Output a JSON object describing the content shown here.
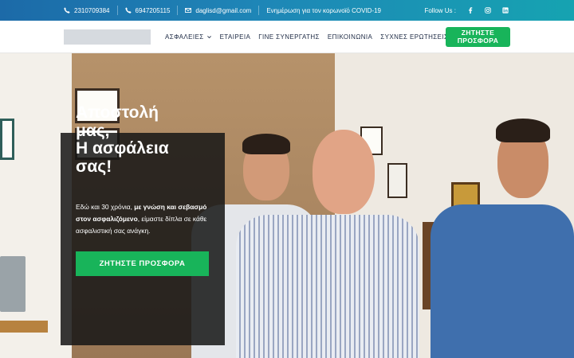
{
  "topbar": {
    "phone1": "2310709384",
    "phone2": "6947205115",
    "email": "daglisd@gmail.com",
    "covid_link": "Ενημέρωση για τον κορωνοϊό COVID-19",
    "follow_label": "Follow Us :",
    "social": [
      "facebook-icon",
      "instagram-icon",
      "linkedin-icon"
    ]
  },
  "header": {
    "nav": [
      {
        "label": "ΑΣΦΑΛΕΙΕΣ",
        "has_dropdown": true
      },
      {
        "label": "ΕΤΑΙΡΕΙΑ"
      },
      {
        "label": "ΓΙΝΕ ΣΥΝΕΡΓΑΤΗΣ"
      },
      {
        "label": "ΕΠΙΚΟΙΝΩΝΙΑ"
      },
      {
        "label": "ΣΥΧΝΕΣ ΕΡΩΤΗΣΕΙΣ"
      }
    ],
    "cta_line1": "ΖΗΤΗΣΤΕ",
    "cta_line2": "ΠΡΟΣΦΟΡΑ"
  },
  "hero": {
    "title_line1": "Αποστολή",
    "title_line2": "μας,",
    "title_line3": "Η ασφάλεια",
    "title_line4": "σας!",
    "text_part1": "Εδώ και 30 χρόνια, ",
    "text_bold": "με γνώση και σεβασμό στον ασφαλιζόμενο",
    "text_part2": ", είμαστε δίπλα σε κάθε ασφαλιστική σας ανάγκη.",
    "cta": "ΖΗΤΗΣΤΕ ΠΡΟΣΦΟΡΑ"
  },
  "colors": {
    "topbar_start": "#1c6aa8",
    "topbar_end": "#16a3b1",
    "accent_green": "#18b45a",
    "nav_text": "#1d2a44"
  }
}
